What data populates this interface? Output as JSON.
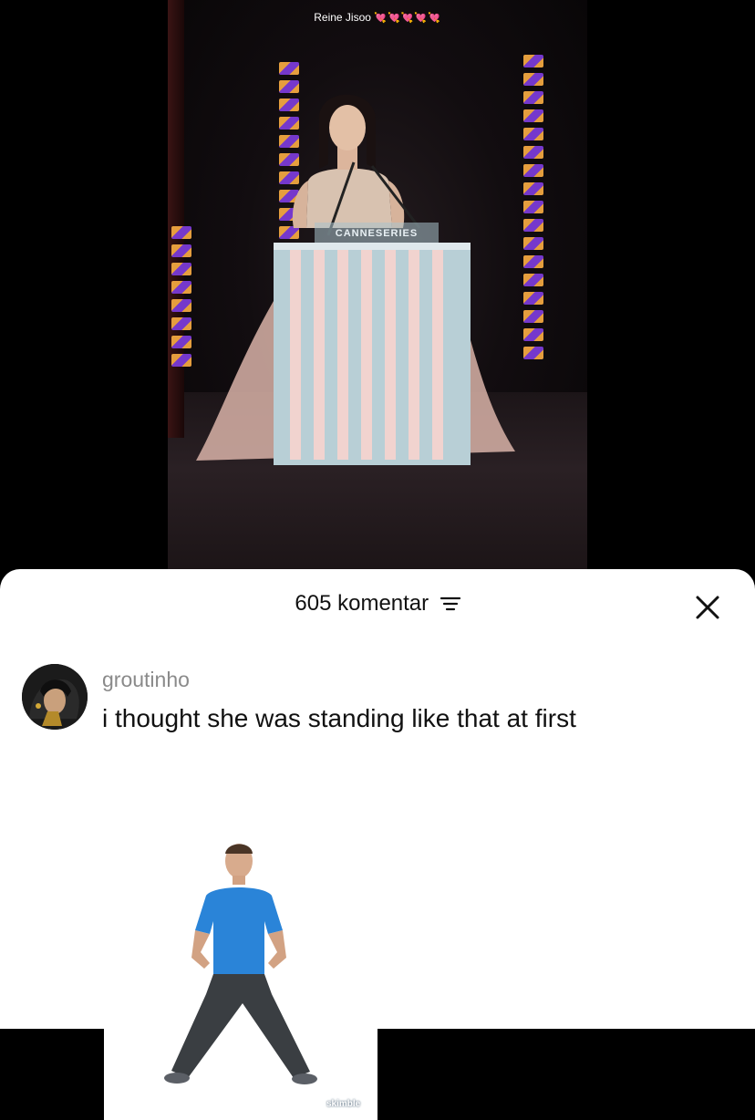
{
  "video": {
    "title": "Reine Jisoo",
    "title_hearts": "💘💘💘💘💘",
    "podium_text": "CANNESERIES"
  },
  "comments_sheet": {
    "count_label": "605 komentar",
    "filter_icon": "filter-lines-icon",
    "close_icon": "close-icon"
  },
  "comment": {
    "username": "groutinho",
    "text": "i thought she was standing like that at first",
    "image_watermark": "skimble"
  }
}
